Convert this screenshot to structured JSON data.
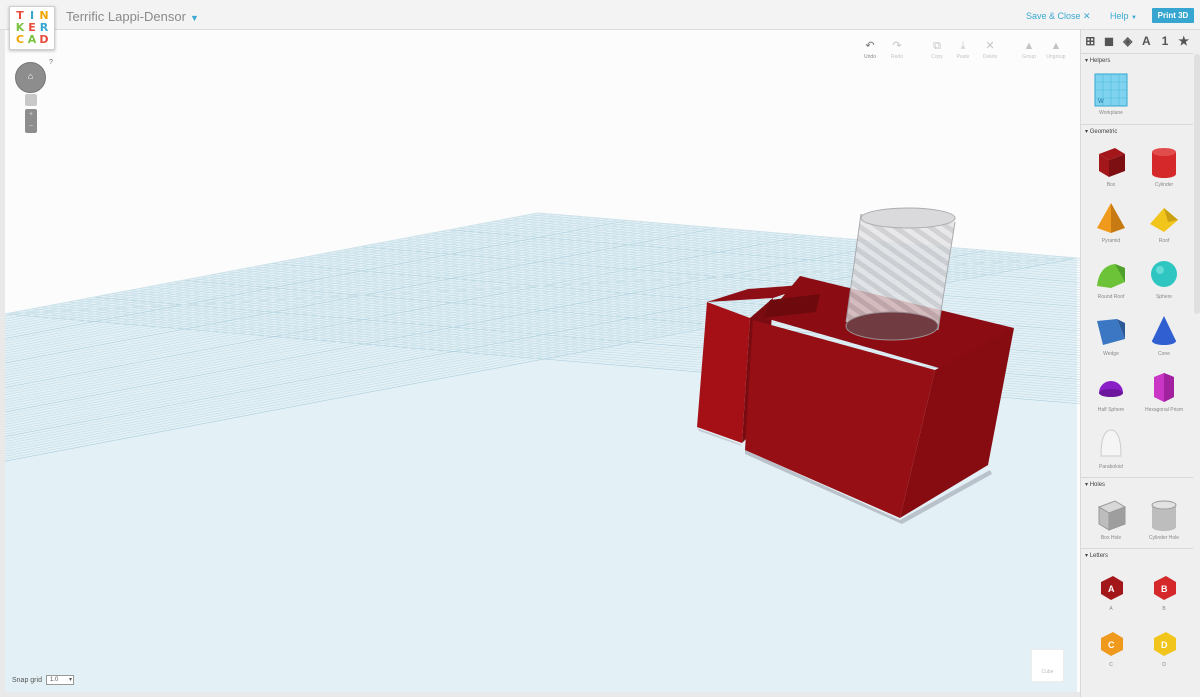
{
  "app": {
    "logo": [
      "T",
      "I",
      "N",
      "K",
      "E",
      "R",
      "C",
      "A",
      "D"
    ],
    "logo_colors": [
      "#e84a3b",
      "#36a6d1",
      "#f0a500",
      "#7cc242",
      "#e84a3b",
      "#36a6d1",
      "#f0a500",
      "#7cc242",
      "#e84a3b"
    ],
    "doc_title": "Terrific Lappi-Densor",
    "save_close": "Save & Close",
    "help": "Help",
    "print3d": "Print 3D"
  },
  "toolbar": [
    {
      "icon": "undo-icon",
      "glyph": "↶",
      "label": "Undo",
      "enabled": true
    },
    {
      "icon": "redo-icon",
      "glyph": "↷",
      "label": "Redo",
      "enabled": false
    },
    {
      "icon": "copy-icon",
      "glyph": "⧉",
      "label": "Copy",
      "enabled": false
    },
    {
      "icon": "paste-icon",
      "glyph": "⤓",
      "label": "Paste",
      "enabled": false
    },
    {
      "icon": "delete-icon",
      "glyph": "✕",
      "label": "Delete",
      "enabled": false
    },
    {
      "icon": "group-icon",
      "glyph": "▲",
      "label": "Group",
      "enabled": false
    },
    {
      "icon": "ungroup-icon",
      "glyph": "▲",
      "label": "Ungroup",
      "enabled": false
    }
  ],
  "snap": {
    "label": "Snap grid",
    "value": "1.0"
  },
  "cube_nav_label": "Cube",
  "panel": {
    "tabs": [
      "⊞",
      "◼",
      "◈",
      "A",
      "1",
      "★"
    ],
    "sections": {
      "helpers": "Helpers",
      "geometric": "Geometric",
      "holes": "Holes",
      "letters": "Letters"
    },
    "helpers": [
      {
        "name": "Workplane"
      }
    ],
    "geometric": [
      {
        "name": "Box",
        "color": "#a3171b"
      },
      {
        "name": "Cylinder",
        "color": "#d4282a"
      },
      {
        "name": "Pyramid",
        "color": "#f09a1d"
      },
      {
        "name": "Roof",
        "color": "#f1c51c"
      },
      {
        "name": "Round Roof",
        "color": "#6cc337"
      },
      {
        "name": "Sphere",
        "color": "#2fc6c1"
      },
      {
        "name": "Wedge",
        "color": "#3b77c2"
      },
      {
        "name": "Cone",
        "color": "#2f5fd0"
      },
      {
        "name": "Half Sphere",
        "color": "#8a1fc8"
      },
      {
        "name": "Hexagonal Prism",
        "color": "#c936c5"
      },
      {
        "name": "Paraboloid",
        "color": "#f5f5f5"
      }
    ],
    "holes": [
      {
        "name": "Box Hole"
      },
      {
        "name": "Cylinder Hole"
      }
    ],
    "letters": [
      {
        "name": "A",
        "color": "#a3171b"
      },
      {
        "name": "B",
        "color": "#d4282a"
      },
      {
        "name": "C",
        "color": "#f09a1d"
      },
      {
        "name": "D",
        "color": "#f1c51c"
      }
    ]
  }
}
